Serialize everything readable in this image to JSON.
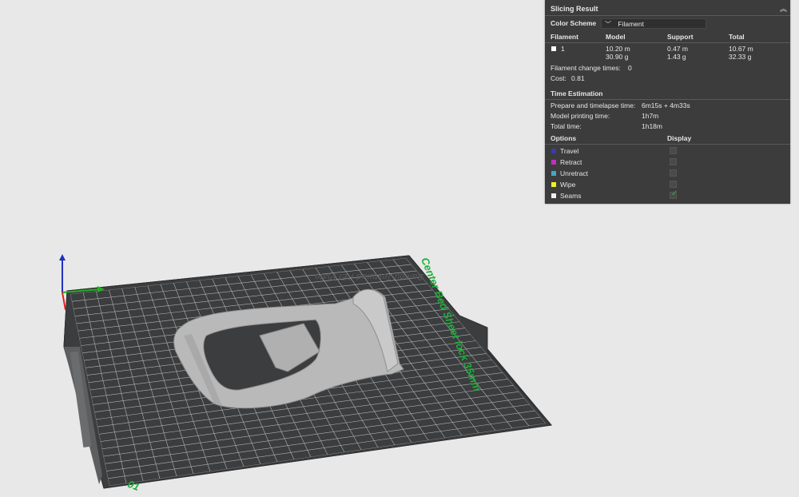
{
  "panel": {
    "title": "Slicing Result",
    "collapse_icon": "double-chevron-up-icon",
    "color_scheme": {
      "label": "Color Scheme",
      "value": "Filament",
      "icon": "chevron-down-icon"
    },
    "table": {
      "headers": [
        "Filament",
        "Model",
        "Support",
        "Total"
      ],
      "rows": [
        {
          "filament": "1",
          "swatch": "#ffffff",
          "model": [
            "10.20 m",
            "30.90 g"
          ],
          "support": [
            "0.47 m",
            "1.43 g"
          ],
          "total": [
            "10.67 m",
            "32.33 g"
          ]
        }
      ]
    },
    "filament_change": {
      "label": "Filament change times:",
      "value": "0"
    },
    "cost": {
      "label": "Cost:",
      "value": "0.81"
    },
    "time_estimation": {
      "title": "Time Estimation",
      "rows": [
        {
          "label": "Prepare and timelapse time:",
          "value": "6m15s + 4m33s"
        },
        {
          "label": "Model printing time:",
          "value": "1h7m"
        },
        {
          "label": "Total time:",
          "value": "1h18m"
        }
      ]
    },
    "options": {
      "headers": [
        "Options",
        "Display"
      ],
      "rows": [
        {
          "label": "Travel",
          "color": "#3b3baa",
          "checked": false
        },
        {
          "label": "Retract",
          "color": "#c02fc0",
          "checked": false
        },
        {
          "label": "Unretract",
          "color": "#3fa9c9",
          "checked": false
        },
        {
          "label": "Wipe",
          "color": "#f2f21a",
          "checked": false
        },
        {
          "label": "Seams",
          "color": "#eeeeee",
          "checked": true
        }
      ]
    }
  },
  "viewport": {
    "bed_label": "Center Bed Sheet lock 35mm",
    "plate_text": "Bambu Textured PEI Plate",
    "bed_number": "01",
    "axis_colors": {
      "x": "#e02020",
      "y": "#20b020",
      "z": "#2030c0"
    },
    "bed_color": "#3b3d3f",
    "grid_color": "#c8c8c8",
    "model_color": "#b9b9b9"
  }
}
